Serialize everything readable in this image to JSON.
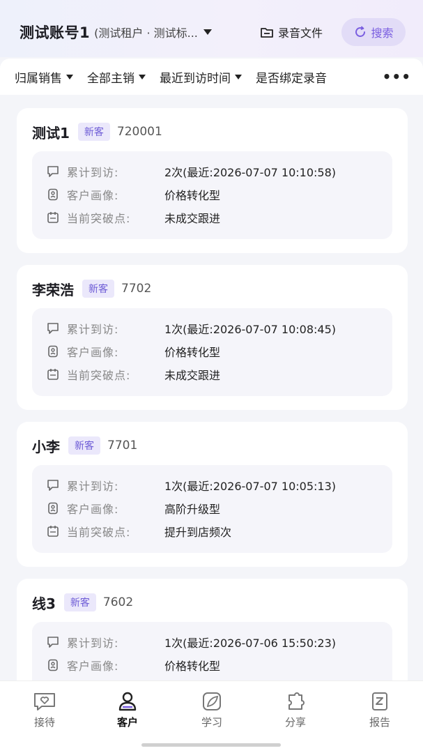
{
  "header": {
    "account_name": "测试账号1",
    "account_sub": "(测试租户 · 测试标...",
    "record_label": "录音文件",
    "search_label": "搜索"
  },
  "filters": [
    {
      "label": "归属销售"
    },
    {
      "label": "全部主销"
    },
    {
      "label": "最近到访时间"
    },
    {
      "label": "是否绑定录音"
    }
  ],
  "more_label": "•••",
  "field_labels": {
    "visits": "累计到访:",
    "portrait": "客户画像:",
    "breakpoint": "当前突破点:"
  },
  "customers": [
    {
      "name": "测试1",
      "tag": "新客",
      "id": "720001",
      "visits": "2次(最近:2026-07-07 10:10:58)",
      "portrait": "价格转化型",
      "breakpoint": "未成交跟进"
    },
    {
      "name": "李荣浩",
      "tag": "新客",
      "id": "7702",
      "visits": "1次(最近:2026-07-07 10:08:45)",
      "portrait": "价格转化型",
      "breakpoint": "未成交跟进"
    },
    {
      "name": "小李",
      "tag": "新客",
      "id": "7701",
      "visits": "1次(最近:2026-07-07 10:05:13)",
      "portrait": "高阶升级型",
      "breakpoint": "提升到店频次"
    },
    {
      "name": "线3",
      "tag": "新客",
      "id": "7602",
      "visits": "1次(最近:2026-07-06 15:50:23)",
      "portrait": "价格转化型",
      "breakpoint": ""
    }
  ],
  "tabs": [
    {
      "label": "接待",
      "icon": "heart-chat-icon"
    },
    {
      "label": "客户",
      "icon": "person-icon",
      "active": true
    },
    {
      "label": "学习",
      "icon": "leaf-icon"
    },
    {
      "label": "分享",
      "icon": "puzzle-icon"
    },
    {
      "label": "报告",
      "icon": "report-icon"
    }
  ],
  "colors": {
    "accent": "#7a5ee0",
    "tag_bg": "#ebe8fb",
    "tag_text": "#6d5bd6"
  }
}
